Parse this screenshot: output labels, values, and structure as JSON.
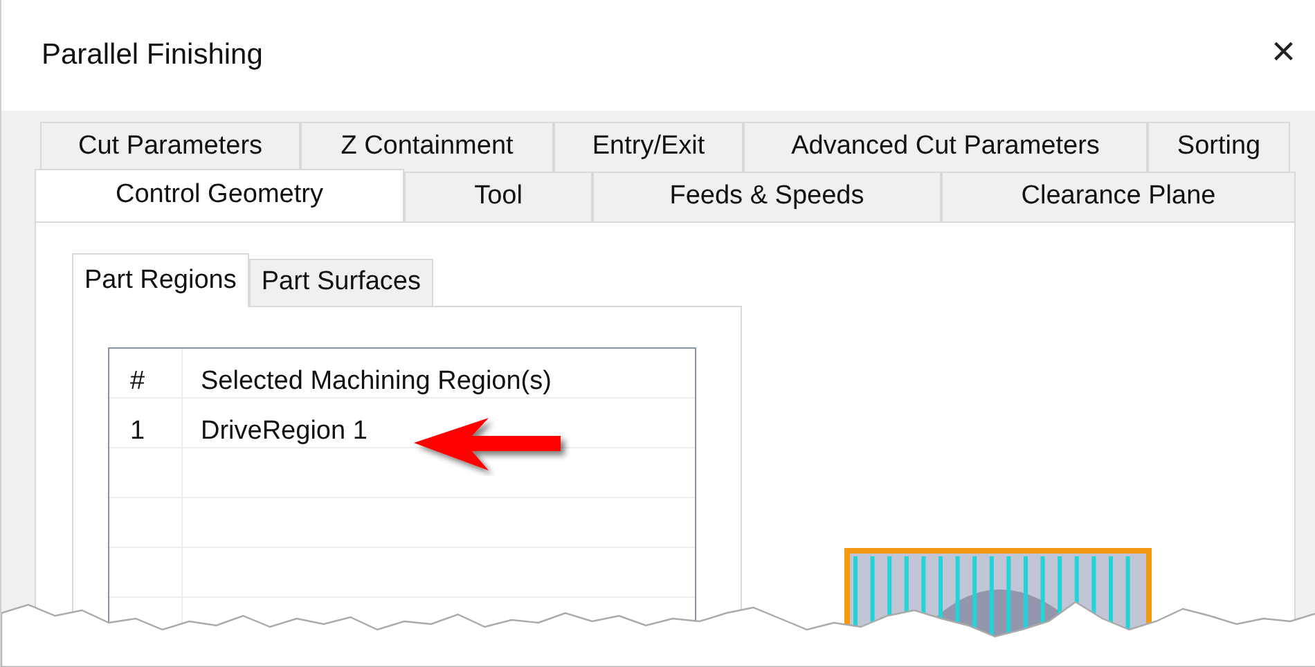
{
  "window": {
    "title": "Parallel Finishing",
    "close": "×"
  },
  "tab_rows": [
    {
      "tabs": [
        {
          "label": "Cut Parameters",
          "selected": false
        },
        {
          "label": "Z Containment",
          "selected": false
        },
        {
          "label": "Entry/Exit",
          "selected": false
        },
        {
          "label": "Advanced Cut Parameters",
          "selected": false
        },
        {
          "label": "Sorting",
          "selected": false
        }
      ]
    },
    {
      "tabs": [
        {
          "label": "Control Geometry",
          "selected": true
        },
        {
          "label": "Tool",
          "selected": false
        },
        {
          "label": "Feeds & Speeds",
          "selected": false
        },
        {
          "label": "Clearance Plane",
          "selected": false
        }
      ]
    }
  ],
  "sub_tabs": [
    {
      "label": "Part Regions",
      "selected": true
    },
    {
      "label": "Part Surfaces",
      "selected": false
    }
  ],
  "table": {
    "columns": [
      "#",
      "Selected Machining Region(s)"
    ],
    "rows": [
      [
        "1",
        "DriveRegion 1"
      ]
    ]
  }
}
